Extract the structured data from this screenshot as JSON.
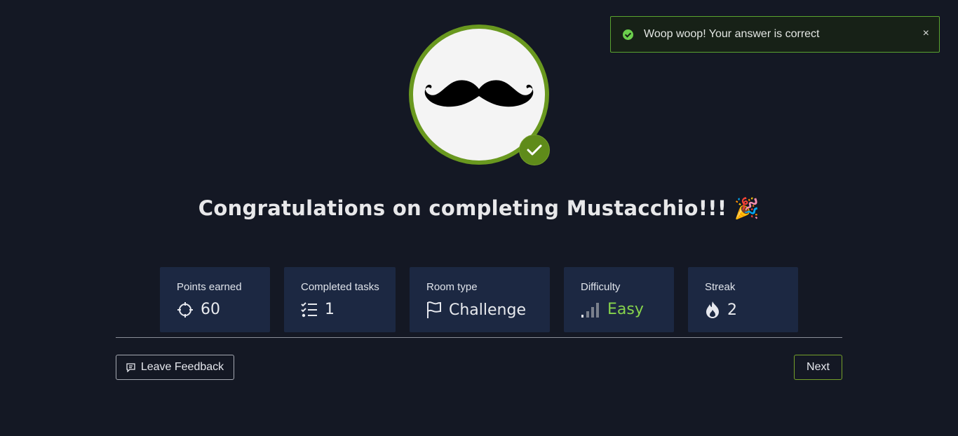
{
  "toast": {
    "message": "Woop woop! Your answer is correct",
    "close_glyph": "×"
  },
  "header": {
    "avatar_icon": "mustache-icon",
    "completed_icon": "check-icon",
    "title": "Congratulations on completing Mustacchio!!!",
    "title_emoji": "🎉"
  },
  "stats": [
    {
      "label": "Points earned",
      "value": "60",
      "icon": "crosshair-icon"
    },
    {
      "label": "Completed tasks",
      "value": "1",
      "icon": "checklist-icon"
    },
    {
      "label": "Room type",
      "value": "Challenge",
      "icon": "flag-icon"
    },
    {
      "label": "Difficulty",
      "value": "Easy",
      "icon": "signal-bars-icon"
    },
    {
      "label": "Streak",
      "value": "2",
      "icon": "flame-icon"
    }
  ],
  "actions": {
    "feedback_label": "Leave Feedback",
    "next_label": "Next"
  },
  "colors": {
    "accent": "#69981f",
    "success": "#6bcf4c",
    "easy": "#86d34c",
    "card_bg": "#1c2842",
    "page_bg": "#141824"
  }
}
